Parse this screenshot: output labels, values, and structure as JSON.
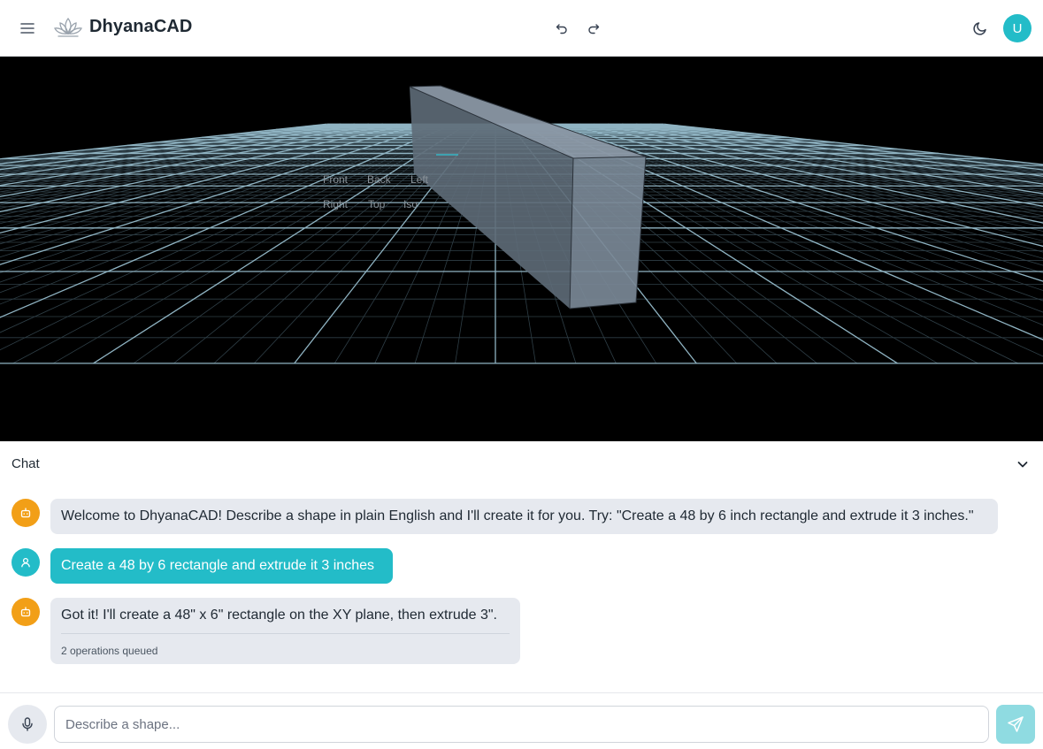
{
  "app": {
    "name": "DhyanaCAD"
  },
  "header": {
    "menu_icon": "hamburger-menu-icon",
    "logo_icon": "lotus-logo-icon",
    "undo_icon": "undo-icon",
    "redo_icon": "redo-icon",
    "theme_icon": "moon-icon",
    "avatar_initial": "U"
  },
  "viewport": {
    "view_buttons": [
      "Front",
      "Back",
      "Left",
      "Right",
      "Top",
      "Iso"
    ],
    "background": "#000000",
    "grid_color": "#5a7d8c",
    "shape_color": "#7c8a98"
  },
  "chat": {
    "title": "Chat",
    "collapse_icon": "chevron-down-icon",
    "messages": [
      {
        "role": "assistant",
        "icon": "robot-icon",
        "text": "Welcome to DhyanaCAD! Describe a shape in plain English and I'll create it for you. Try: \"Create a 48 by 6 inch rectangle and extrude it 3 inches.\""
      },
      {
        "role": "user",
        "icon": "user-icon",
        "text": "Create a 48 by 6 rectangle and extrude it 3 inches"
      },
      {
        "role": "assistant",
        "icon": "robot-icon",
        "text": "Got it! I'll create a 48\" x 6\" rectangle on the XY plane, then extrude 3\".",
        "meta": "2 operations queued"
      }
    ]
  },
  "input": {
    "placeholder": "Describe a shape...",
    "value": "",
    "mic_icon": "microphone-icon",
    "send_icon": "send-icon"
  },
  "colors": {
    "accent": "#23bcc8",
    "assistant_avatar": "#f29f17",
    "bubble_assistant": "#e6e9ef"
  }
}
